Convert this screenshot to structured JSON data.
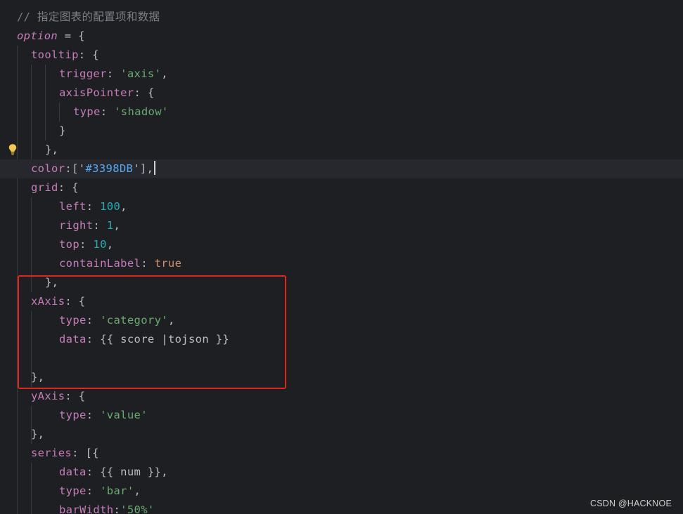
{
  "editor": {
    "lines": [
      {
        "tokens": [
          {
            "t": "// 指定图表的配置项和数据",
            "c": "t-cmt"
          }
        ]
      },
      {
        "tokens": [
          {
            "t": "option",
            "c": "t-kw"
          },
          {
            "t": " = {",
            "c": "t-punct"
          }
        ]
      },
      {
        "tokens": [
          {
            "t": "tooltip",
            "c": "t-prop"
          },
          {
            "t": ": {",
            "c": "t-punct"
          }
        ]
      },
      {
        "tokens": [
          {
            "t": "trigger",
            "c": "t-prop"
          },
          {
            "t": ": ",
            "c": "t-punct"
          },
          {
            "t": "'axis'",
            "c": "t-str"
          },
          {
            "t": ",",
            "c": "t-punct"
          }
        ]
      },
      {
        "tokens": [
          {
            "t": "axisPointer",
            "c": "t-prop"
          },
          {
            "t": ": {",
            "c": "t-punct"
          }
        ]
      },
      {
        "tokens": [
          {
            "t": "type",
            "c": "t-prop"
          },
          {
            "t": ": ",
            "c": "t-punct"
          },
          {
            "t": "'shadow'",
            "c": "t-str"
          }
        ]
      },
      {
        "tokens": [
          {
            "t": "}",
            "c": "t-punct"
          }
        ]
      },
      {
        "tokens": [
          {
            "t": "},",
            "c": "t-punct"
          }
        ]
      },
      {
        "tokens": [
          {
            "t": "color",
            "c": "t-prop"
          },
          {
            "t": ":['",
            "c": "t-punct"
          },
          {
            "t": "#3398DB",
            "c": "t-str-blue"
          },
          {
            "t": "'],",
            "c": "t-punct"
          }
        ]
      },
      {
        "tokens": [
          {
            "t": "grid",
            "c": "t-prop"
          },
          {
            "t": ": {",
            "c": "t-punct"
          }
        ]
      },
      {
        "tokens": [
          {
            "t": "left",
            "c": "t-prop"
          },
          {
            "t": ": ",
            "c": "t-punct"
          },
          {
            "t": "100",
            "c": "t-num"
          },
          {
            "t": ",",
            "c": "t-punct"
          }
        ]
      },
      {
        "tokens": [
          {
            "t": "right",
            "c": "t-prop"
          },
          {
            "t": ": ",
            "c": "t-punct"
          },
          {
            "t": "1",
            "c": "t-num"
          },
          {
            "t": ",",
            "c": "t-punct"
          }
        ]
      },
      {
        "tokens": [
          {
            "t": "top",
            "c": "t-prop"
          },
          {
            "t": ": ",
            "c": "t-punct"
          },
          {
            "t": "10",
            "c": "t-num"
          },
          {
            "t": ",",
            "c": "t-punct"
          }
        ]
      },
      {
        "tokens": [
          {
            "t": "containLabel",
            "c": "t-prop"
          },
          {
            "t": ": ",
            "c": "t-punct"
          },
          {
            "t": "true",
            "c": "t-bool"
          }
        ]
      },
      {
        "tokens": [
          {
            "t": "},",
            "c": "t-punct"
          }
        ]
      },
      {
        "tokens": [
          {
            "t": "xAxis",
            "c": "t-prop"
          },
          {
            "t": ": {",
            "c": "t-punct"
          }
        ]
      },
      {
        "tokens": [
          {
            "t": "type",
            "c": "t-prop"
          },
          {
            "t": ": ",
            "c": "t-punct"
          },
          {
            "t": "'category'",
            "c": "t-str"
          },
          {
            "t": ",",
            "c": "t-punct"
          }
        ]
      },
      {
        "tokens": [
          {
            "t": "data",
            "c": "t-prop"
          },
          {
            "t": ": {{ score |tojson }}",
            "c": "t-tpl"
          }
        ]
      },
      {
        "tokens": []
      },
      {
        "tokens": [
          {
            "t": "},",
            "c": "t-punct"
          }
        ]
      },
      {
        "tokens": [
          {
            "t": "yAxis",
            "c": "t-prop"
          },
          {
            "t": ": {",
            "c": "t-punct"
          }
        ]
      },
      {
        "tokens": [
          {
            "t": "type",
            "c": "t-prop"
          },
          {
            "t": ": ",
            "c": "t-punct"
          },
          {
            "t": "'value'",
            "c": "t-str"
          }
        ]
      },
      {
        "tokens": [
          {
            "t": "},",
            "c": "t-punct"
          }
        ]
      },
      {
        "tokens": [
          {
            "t": "series",
            "c": "t-prop"
          },
          {
            "t": ": [{",
            "c": "t-punct"
          }
        ]
      },
      {
        "tokens": [
          {
            "t": "data",
            "c": "t-prop"
          },
          {
            "t": ": {{ num }},",
            "c": "t-tpl"
          }
        ]
      },
      {
        "tokens": [
          {
            "t": "type",
            "c": "t-prop"
          },
          {
            "t": ": ",
            "c": "t-punct"
          },
          {
            "t": "'bar'",
            "c": "t-str"
          },
          {
            "t": ",",
            "c": "t-punct"
          }
        ]
      },
      {
        "tokens": [
          {
            "t": "barWidth",
            "c": "t-prop"
          },
          {
            "t": ":",
            "c": "t-punct"
          },
          {
            "t": "'50%'",
            "c": "t-str"
          }
        ]
      }
    ],
    "caret_line": 8,
    "intention_bulb_line": 7,
    "current_line": 8
  },
  "annotation": {
    "color": "#e1251b",
    "target": "xAxis block"
  },
  "watermark": {
    "text": "CSDN @HACKNOE"
  },
  "theme": {
    "background": "#1e1f22",
    "current_line_bg": "#26282e"
  }
}
